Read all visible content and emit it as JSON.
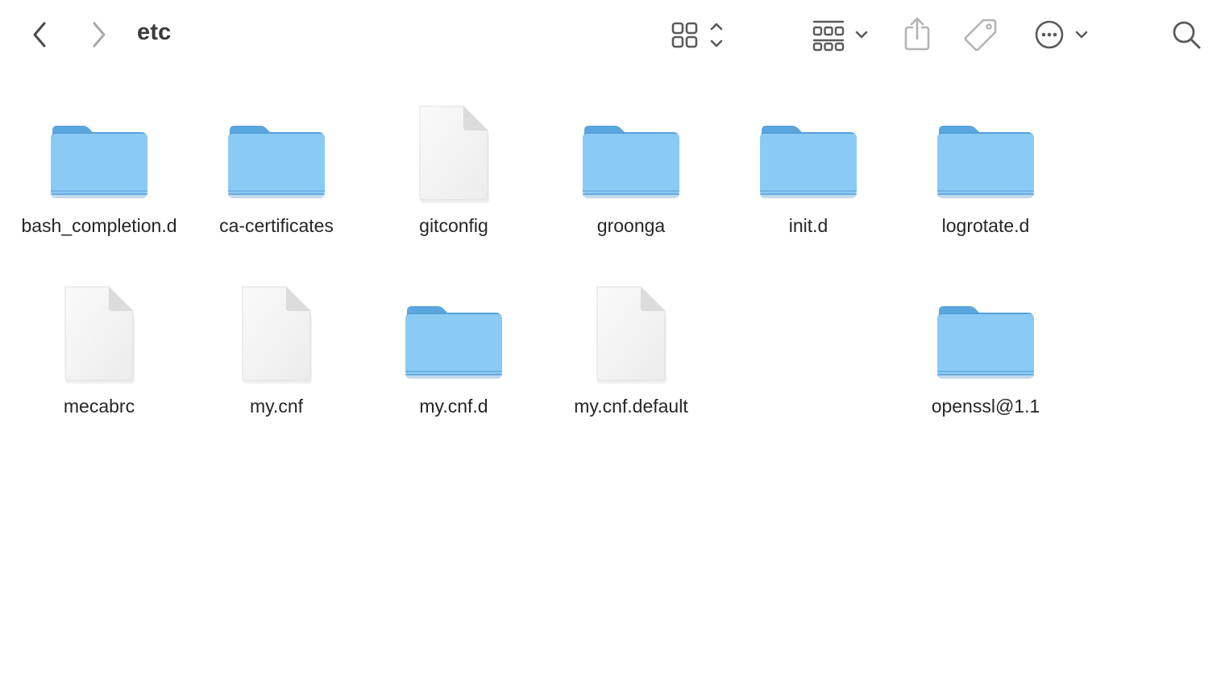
{
  "window": {
    "title": "etc"
  },
  "toolbar": {
    "back": "chevron-left-icon",
    "forward": "chevron-right-icon",
    "view_mode": "icon-view-icon",
    "group": "group-by-icon",
    "share": "share-icon",
    "tags": "tag-icon",
    "more": "ellipsis-circle-icon",
    "search": "search-icon"
  },
  "colors": {
    "folder_front": "#8ACBF5",
    "folder_back": "#5AA6DE",
    "doc": "#F2F2F2"
  },
  "items": [
    {
      "name": "bash_completion.d",
      "kind": "folder"
    },
    {
      "name": "ca-certificates",
      "kind": "folder"
    },
    {
      "name": "gitconfig",
      "kind": "file"
    },
    {
      "name": "groonga",
      "kind": "folder"
    },
    {
      "name": "init.d",
      "kind": "folder"
    },
    {
      "name": "logrotate.d",
      "kind": "folder"
    },
    {
      "name": "mecabrc",
      "kind": "file"
    },
    {
      "name": "my.cnf",
      "kind": "file"
    },
    {
      "name": "my.cnf.d",
      "kind": "folder"
    },
    {
      "name": "my.cnf.default",
      "kind": "file"
    },
    {
      "name": "openssl@1.1",
      "kind": "folder"
    }
  ]
}
